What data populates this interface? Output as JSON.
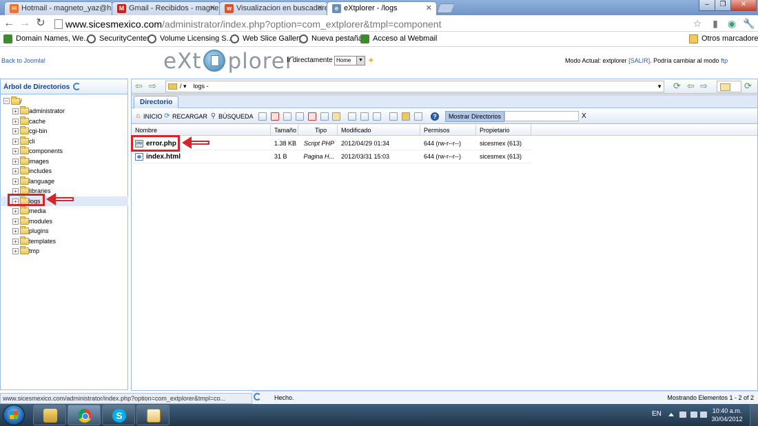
{
  "browser": {
    "tabs": [
      {
        "title": "Hotmail - magneto_yaz@h",
        "favicon_color": "#e8742f",
        "favicon": "✉"
      },
      {
        "title": "Gmail - Recibidos - magne",
        "favicon_color": "#c5221f",
        "favicon": "M"
      },
      {
        "title": "Visualizacion en buscadore",
        "favicon_color": "#d8542c",
        "favicon": "w"
      },
      {
        "title": "eXtplorer - /logs",
        "favicon_color": "#6d8fb6",
        "favicon": "e"
      }
    ],
    "url_host": "www.sicesmexico.com",
    "url_path": "/administrator/index.php?option=com_extplorer&tmpl=component",
    "bookmarks": [
      {
        "label": "Domain Names, We...",
        "icon": "green"
      },
      {
        "label": "SecurityCenter",
        "icon": "globe"
      },
      {
        "label": "Volume Licensing S...",
        "icon": "globe"
      },
      {
        "label": "Web Slice Gallery",
        "icon": "globe"
      },
      {
        "label": "Nueva pestaña",
        "icon": "globe"
      },
      {
        "label": "Acceso al Webmail",
        "icon": "green"
      }
    ],
    "other_bookmarks": "Otros marcadores",
    "status_url": "www.sicesmexico.com/administrator/index.php?option=com_extplorer&tmpl=co..."
  },
  "app": {
    "back_link": "Back to Joomla!",
    "logo_left": "eXt",
    "logo_right": "plorer",
    "jump_label": "Ir directamente a:",
    "jump_value": "Home",
    "mode_prefix": "Modo Actual: extplorer",
    "mode_salir": "[SALIR]",
    "mode_middle": ". Podría cambiar al modo",
    "mode_ftp": "ftp"
  },
  "tree": {
    "title": "Árbol de Directorios",
    "root": "/",
    "folders": [
      "administrator",
      "cache",
      "cgi-bin",
      "cli",
      "components",
      "images",
      "includes",
      "language",
      "libraries",
      "logs",
      "media",
      "modules",
      "plugins",
      "templates",
      "tmp"
    ],
    "selected": "logs"
  },
  "main": {
    "path_root": "/",
    "path_current": "logs -",
    "tab_label": "Directorio",
    "actions": {
      "home": "INICIO",
      "reload": "RECARGAR",
      "search": "BÚSQUEDA"
    },
    "show_dirs": "Mostrar Directorios",
    "filter_clear": "X",
    "columns": [
      "Nombre",
      "Tamaño",
      "Tipo",
      "Modificado",
      "Permisos",
      "Propietario"
    ],
    "files": [
      {
        "name": "error.php",
        "size": "1.38 KB",
        "type": "Script PHP",
        "modified": "2012/04/29 01:34",
        "perms": "644 (rw-r--r--)",
        "owner": "sicesmex (613)",
        "icon_text": "php"
      },
      {
        "name": "index.html",
        "size": "31 B",
        "type": "Pagina H...",
        "modified": "2012/03/31 15:03",
        "perms": "644 (rw-r--r--)",
        "owner": "sicesmex (613)",
        "icon_text": ""
      }
    ],
    "status_text": "Hecho.",
    "status_count": "Mostrando Elementos 1 - 2 of 2"
  },
  "taskbar": {
    "lang": "EN",
    "time": "10:40 a.m.",
    "date": "30/04/2012"
  },
  "colors": {
    "annotation": "#d2262c",
    "panel_border": "#99bbe8",
    "header_text": "#15428b"
  }
}
